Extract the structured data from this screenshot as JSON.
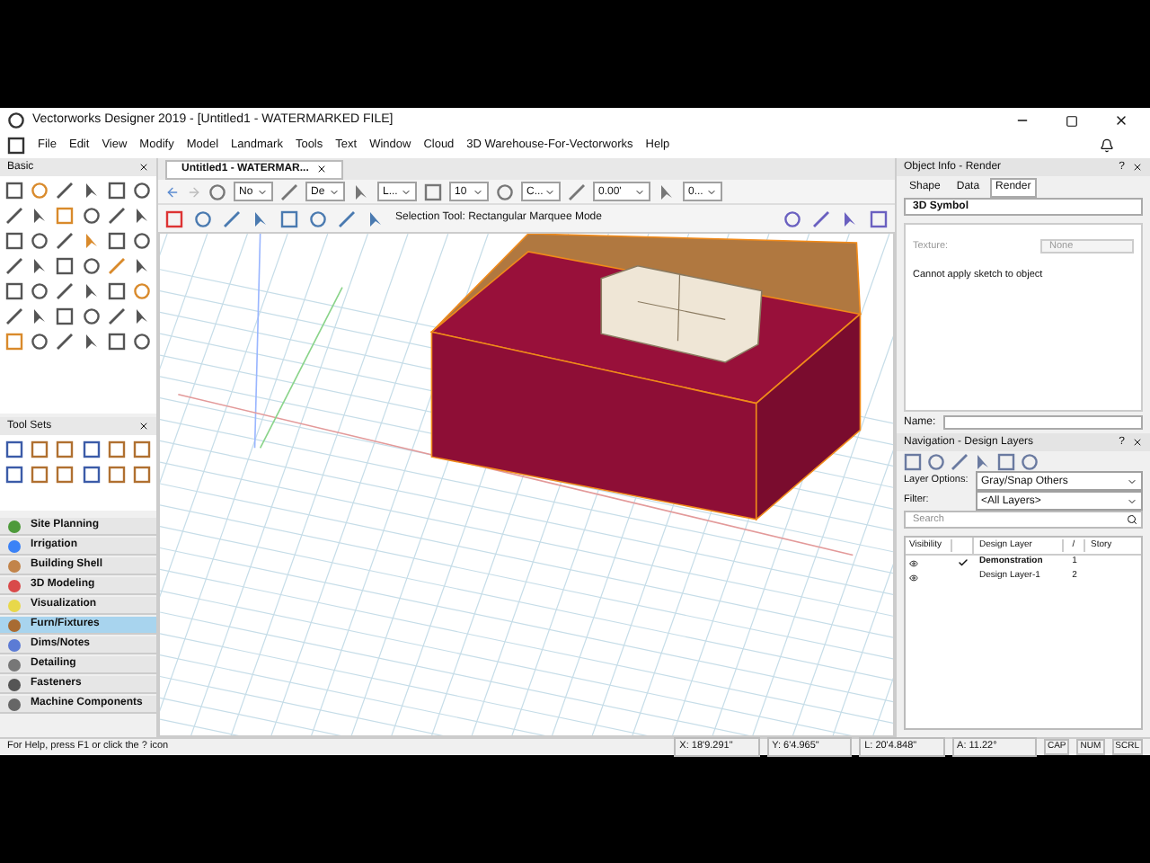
{
  "window": {
    "title": "Vectorworks Designer 2019 - [Untitled1 - WATERMARKED FILE]"
  },
  "menu": [
    "File",
    "Edit",
    "View",
    "Modify",
    "Model",
    "Landmark",
    "Tools",
    "Text",
    "Window",
    "Cloud",
    "3D Warehouse-For-Vectorworks",
    "Help"
  ],
  "basic_palette": {
    "title": "Basic"
  },
  "tool_sets": {
    "title": "Tool Sets",
    "items": [
      {
        "label": "Site Planning",
        "selected": false
      },
      {
        "label": "Irrigation",
        "selected": false
      },
      {
        "label": "Building Shell",
        "selected": false
      },
      {
        "label": "3D Modeling",
        "selected": false
      },
      {
        "label": "Visualization",
        "selected": false
      },
      {
        "label": "Furn/Fixtures",
        "selected": true
      },
      {
        "label": "Dims/Notes",
        "selected": false
      },
      {
        "label": "Detailing",
        "selected": false
      },
      {
        "label": "Fasteners",
        "selected": false
      },
      {
        "label": "Machine Components",
        "selected": false
      }
    ]
  },
  "document_tab": {
    "title": "Untitled1 - WATERMAR..."
  },
  "view_bar": {
    "fields": [
      "No",
      "De",
      "L...",
      "10",
      "C...",
      "0.00'",
      "0..."
    ]
  },
  "mode_bar": {
    "message": "Selection Tool: Rectangular Marquee Mode"
  },
  "object_info": {
    "title": "Object Info - Render",
    "help": "?",
    "tabs": [
      {
        "label": "Shape",
        "selected": false
      },
      {
        "label": "Data",
        "selected": false
      },
      {
        "label": "Render",
        "selected": true
      }
    ],
    "object_type": "3D Symbol",
    "texture_label": "Texture:",
    "texture_value": "None",
    "message": "Cannot apply sketch to object",
    "name_label": "Name:"
  },
  "navigation": {
    "title": "Navigation - Design Layers",
    "help": "?",
    "layer_options_label": "Layer Options:",
    "layer_options_value": "Gray/Snap Others",
    "filter_label": "Filter:",
    "filter_value": "<All Layers>",
    "search_placeholder": "Search",
    "columns": [
      "Visibility",
      "Design Layer",
      "/",
      "Story"
    ],
    "rows": [
      {
        "name": "Demonstration",
        "number": "1",
        "active": true
      },
      {
        "name": "Design Layer-1",
        "number": "2",
        "active": false
      }
    ]
  },
  "status_bar": {
    "help": "For Help, press F1 or click the ? icon",
    "x": "X: 18'9.291\"",
    "y": "Y: 6'4.965\"",
    "l": "L: 20'4.848\"",
    "a": "A: 11.22°",
    "indicators": [
      "CAP",
      "NUM",
      "SCRL"
    ]
  }
}
